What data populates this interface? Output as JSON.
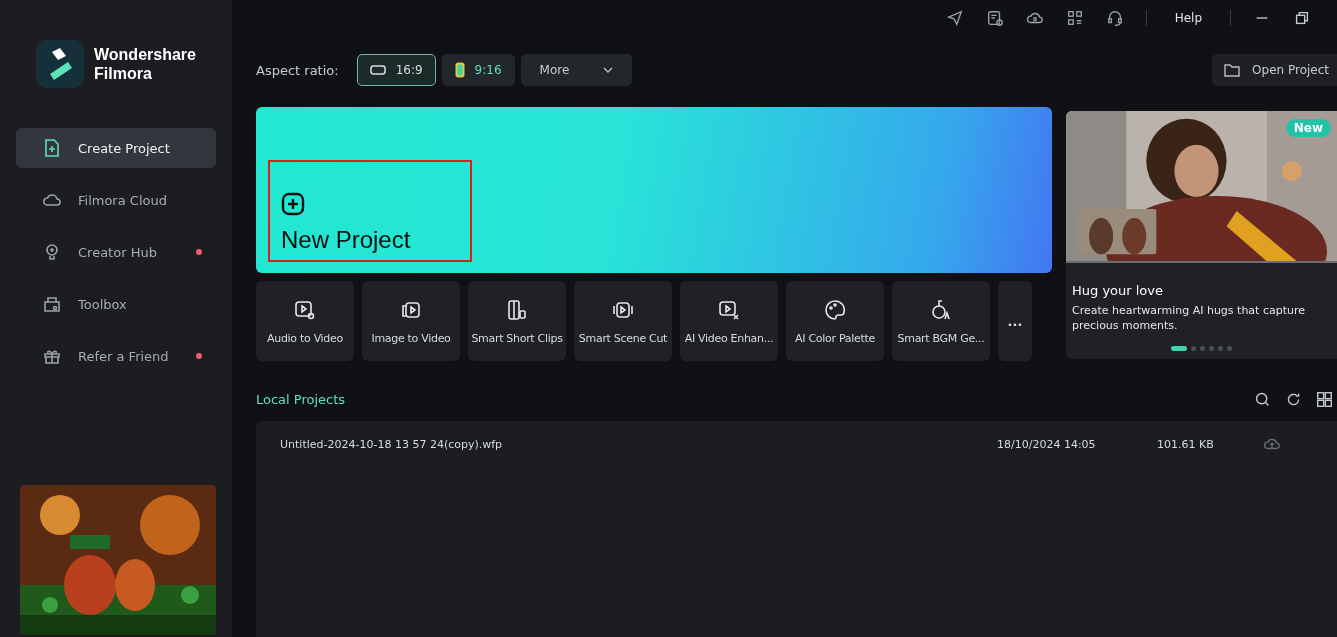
{
  "topbar": {
    "help": "Help"
  },
  "brand": {
    "line1": "Wondershare",
    "line2": "Filmora"
  },
  "sidebar": {
    "items": [
      {
        "label": "Create Project",
        "selected": true,
        "notification": false
      },
      {
        "label": "Filmora Cloud",
        "selected": false,
        "notification": false
      },
      {
        "label": "Creator Hub",
        "selected": false,
        "notification": true
      },
      {
        "label": "Toolbox",
        "selected": false,
        "notification": false
      },
      {
        "label": "Refer a Friend",
        "selected": false,
        "notification": true
      }
    ]
  },
  "aspect": {
    "label": "Aspect ratio:",
    "options": [
      {
        "label": "16:9",
        "selected": true
      },
      {
        "label": "9:16",
        "selected": false
      }
    ],
    "more": "More"
  },
  "open_project": "Open Project",
  "new_project": {
    "label": "New Project"
  },
  "tools": [
    "Audio to Video",
    "Image to Video",
    "Smart Short Clips",
    "Smart Scene Cut",
    "AI Video Enhan...",
    "AI Color Palette",
    "Smart BGM Ge..."
  ],
  "tools_more": "...",
  "promo": {
    "badge": "New",
    "title": "Hug your love",
    "text": "Create heartwarming AI hugs that capture precious moments.",
    "dots": [
      {
        "selected": true
      },
      {
        "selected": false
      },
      {
        "selected": false
      },
      {
        "selected": false
      },
      {
        "selected": false
      },
      {
        "selected": false
      }
    ]
  },
  "local_projects": {
    "title": "Local Projects",
    "rows": [
      {
        "name": "Untitled-2024-10-18 13 57 24(copy).wfp",
        "date": "18/10/2024 14:05",
        "size": "101.61 KB"
      }
    ]
  }
}
